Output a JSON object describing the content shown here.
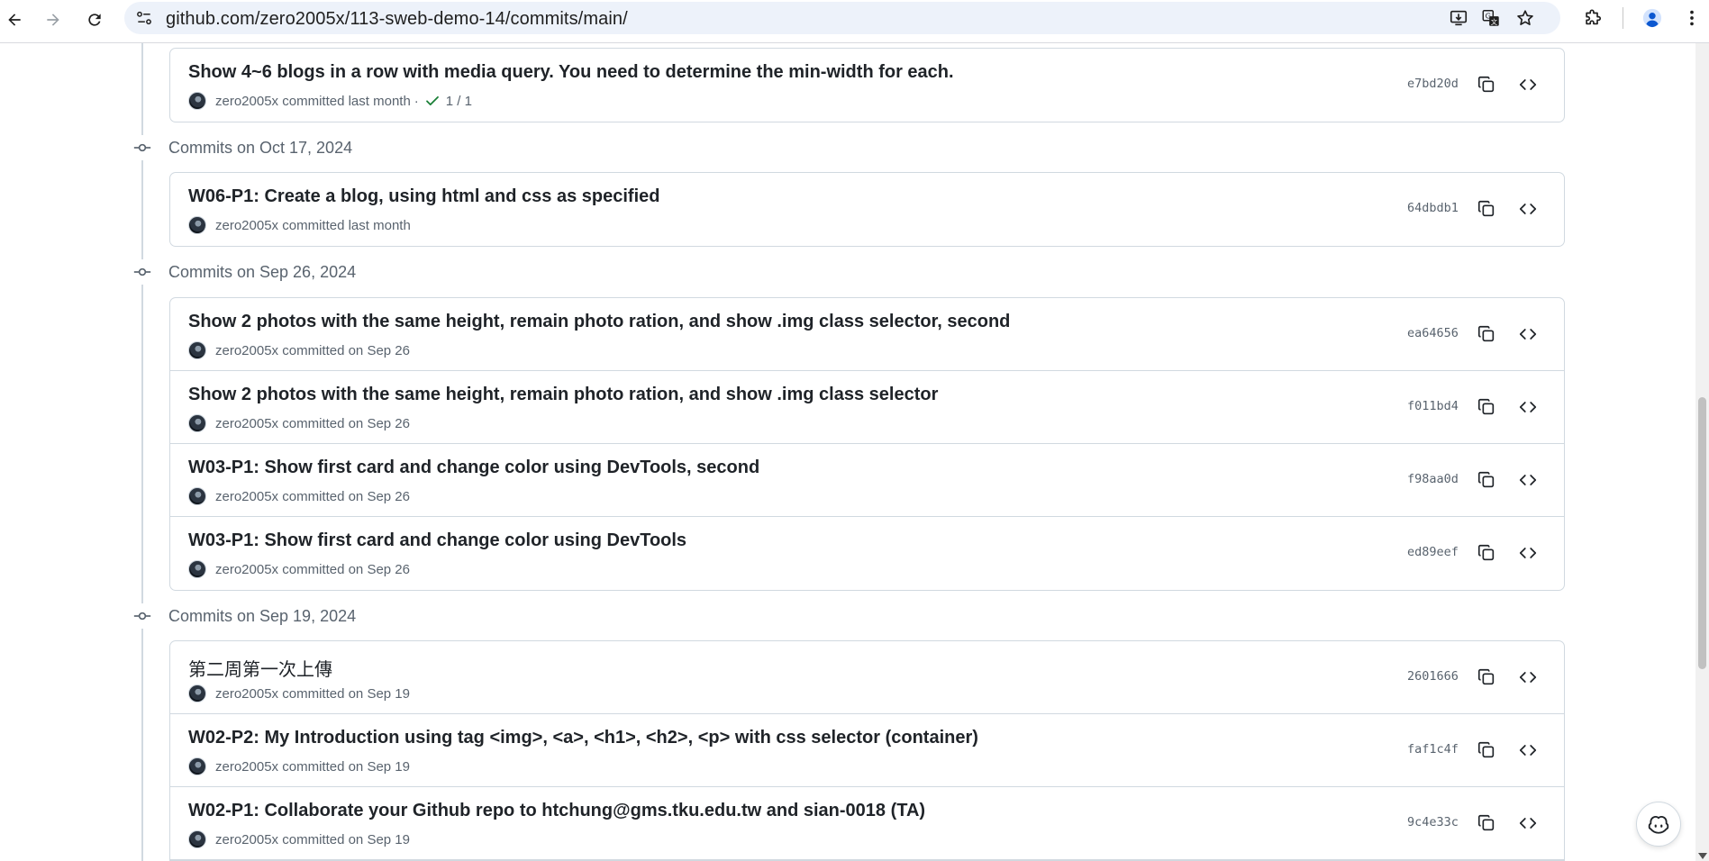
{
  "browser": {
    "url": "github.com/zero2005x/113-sweb-demo-14/commits/main/",
    "icons": [
      "back-arrow-icon",
      "forward-arrow-icon",
      "reload-icon",
      "site-settings-icon",
      "install-app-icon",
      "translate-icon",
      "bookmark-star-icon",
      "extensions-icon",
      "profile-icon",
      "more-menu-icon"
    ]
  },
  "groups": [
    {
      "title": "",
      "commits": [
        {
          "message": "Show 4~6 blogs in a row with media query. You need to determine the min-width for each.",
          "author": "zero2005x",
          "action": "committed",
          "time": "last month",
          "checks": "1 / 1",
          "sha": "e7bd20d"
        }
      ]
    },
    {
      "title": "Commits on Oct 17, 2024",
      "commits": [
        {
          "message": "W06-P1: Create a blog, using html and css as specified",
          "author": "zero2005x",
          "action": "committed",
          "time": "last month",
          "sha": "64dbdb1"
        }
      ]
    },
    {
      "title": "Commits on Sep 26, 2024",
      "commits": [
        {
          "message": "Show 2 photos with the same height, remain photo ration, and show .img class selector, second",
          "author": "zero2005x",
          "action": "committed",
          "time": "on Sep 26",
          "sha": "ea64656"
        },
        {
          "message": "Show 2 photos with the same height, remain photo ration, and show .img class selector",
          "author": "zero2005x",
          "action": "committed",
          "time": "on Sep 26",
          "sha": "f011bd4"
        },
        {
          "message": "W03-P1: Show first card and change color using DevTools, second",
          "author": "zero2005x",
          "action": "committed",
          "time": "on Sep 26",
          "sha": "f98aa0d"
        },
        {
          "message": "W03-P1: Show first card and change color using DevTools",
          "author": "zero2005x",
          "action": "committed",
          "time": "on Sep 26",
          "sha": "ed89eef"
        }
      ]
    },
    {
      "title": "Commits on Sep 19, 2024",
      "commits": [
        {
          "message": "第二周第一次上傳",
          "author": "zero2005x",
          "action": "committed",
          "time": "on Sep 19",
          "sha": "2601666"
        },
        {
          "message": "W02-P2: My Introduction using tag <img>, <a>, <h1>, <h2>, <p> with css selector (container)",
          "author": "zero2005x",
          "action": "committed",
          "time": "on Sep 19",
          "sha": "faf1c4f"
        },
        {
          "message": "W02-P1: Collaborate your Github repo to htchung@gms.tku.edu.tw and sian-0018 (TA)",
          "author": "zero2005x",
          "action": "committed",
          "time": "on Sep 19",
          "sha": "9c4e33c"
        }
      ]
    }
  ],
  "colors": {
    "check": "#1a7f37",
    "muted": "#59636e",
    "border": "#d1d9e0"
  }
}
